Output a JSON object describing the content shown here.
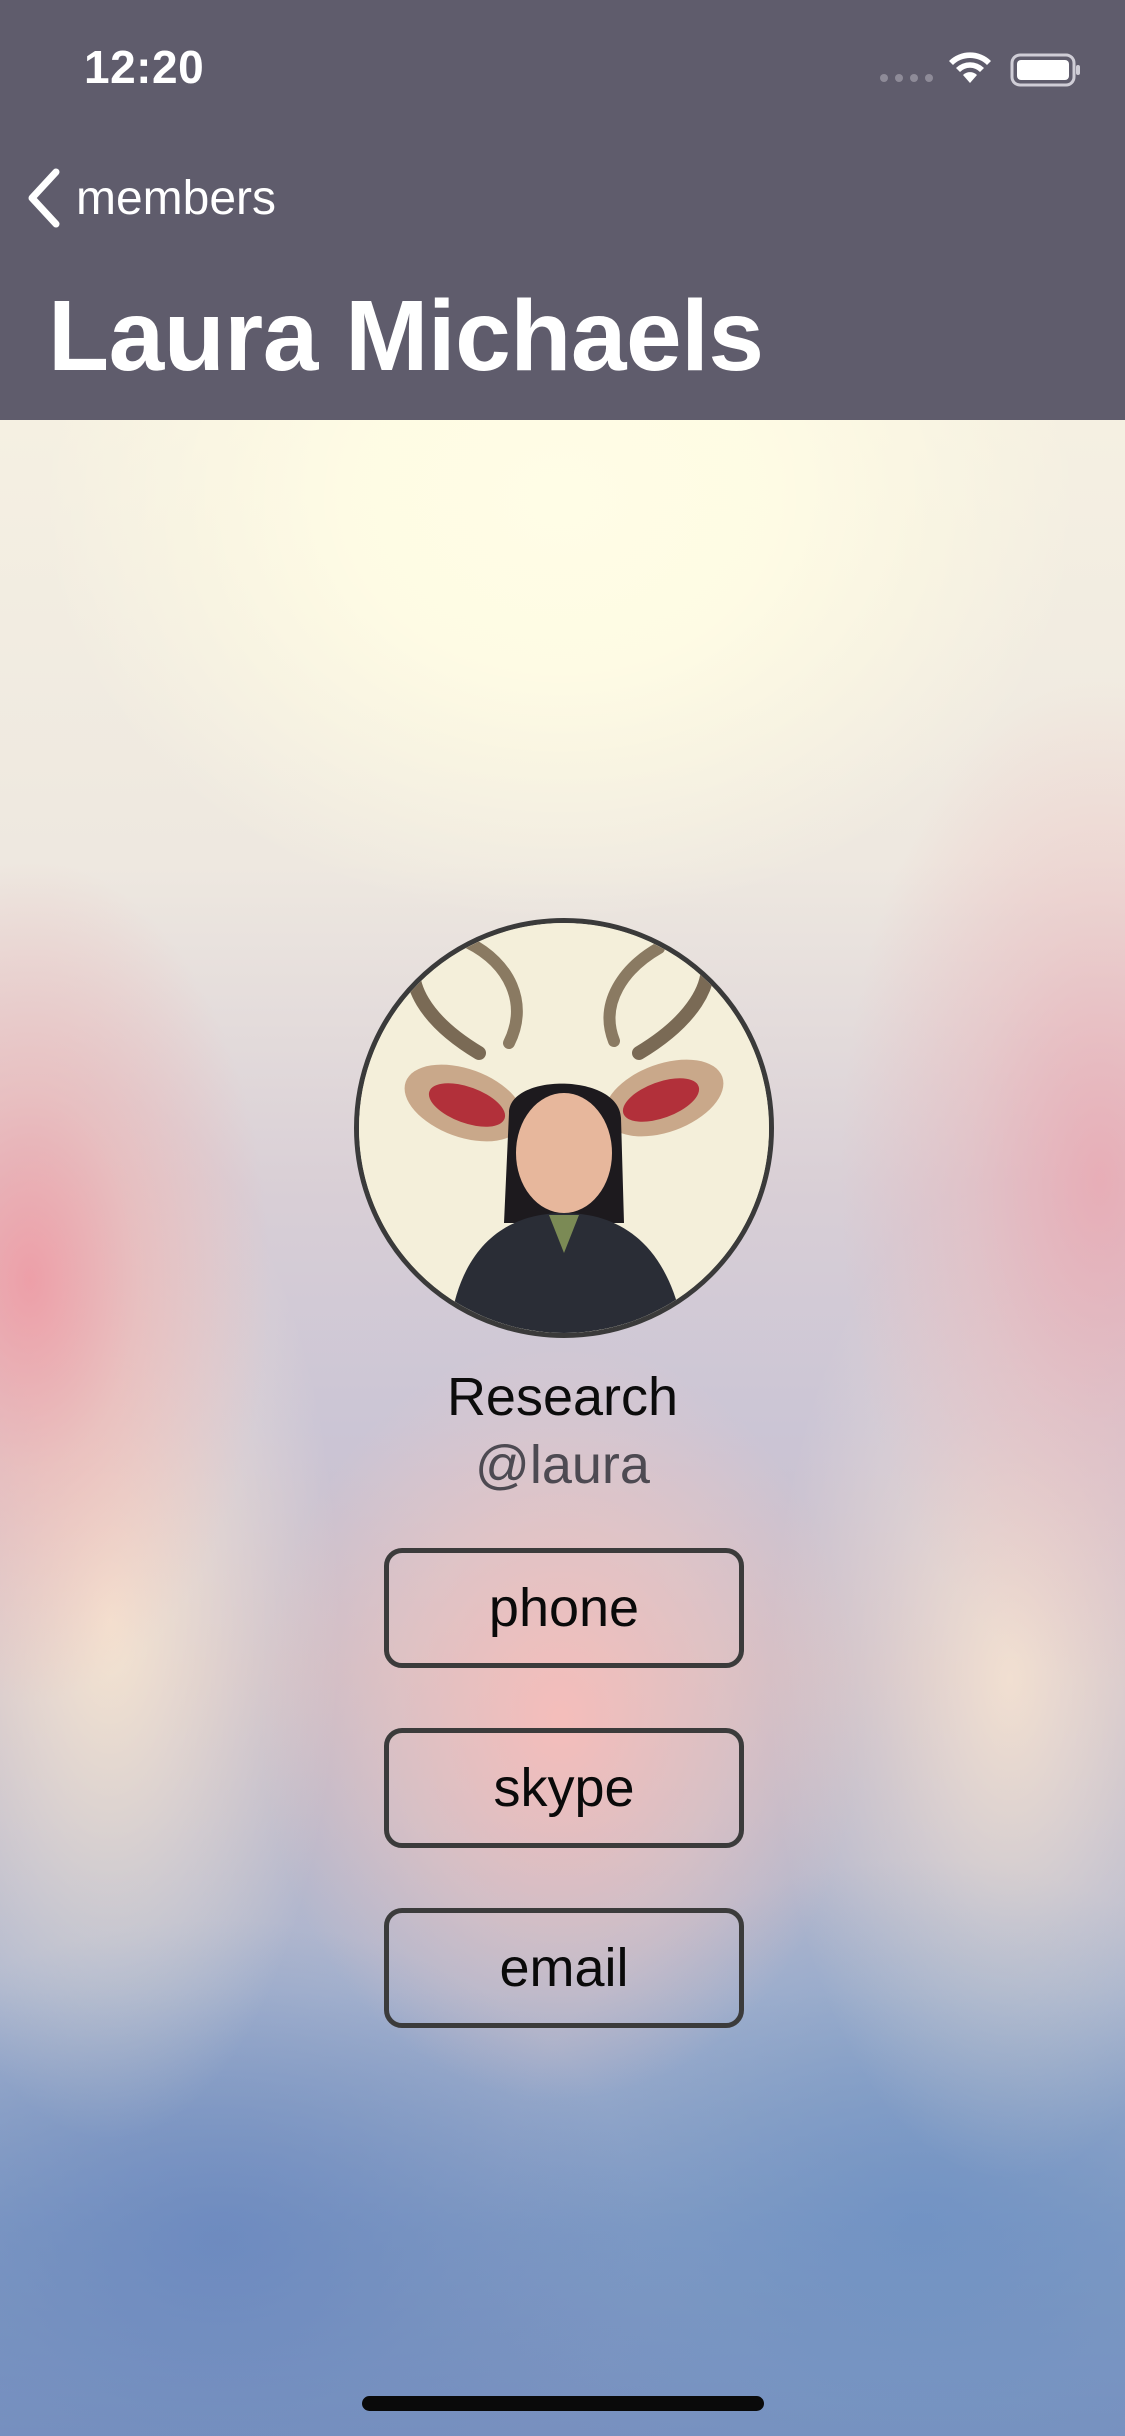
{
  "status_bar": {
    "time": "12:20"
  },
  "nav": {
    "back_label": "members",
    "title": "Laura Michaels"
  },
  "profile": {
    "department": "Research",
    "handle": "@laura"
  },
  "actions": {
    "phone_label": "phone",
    "skype_label": "skype",
    "email_label": "email"
  },
  "colors": {
    "header_bg": "#5f5c6c",
    "text_on_header": "#ffffff",
    "button_border": "#3b3b3b"
  },
  "icons": {
    "back": "chevron-left-icon",
    "wifi": "wifi-icon",
    "battery": "battery-icon",
    "signal": "cellular-signal-icon"
  }
}
